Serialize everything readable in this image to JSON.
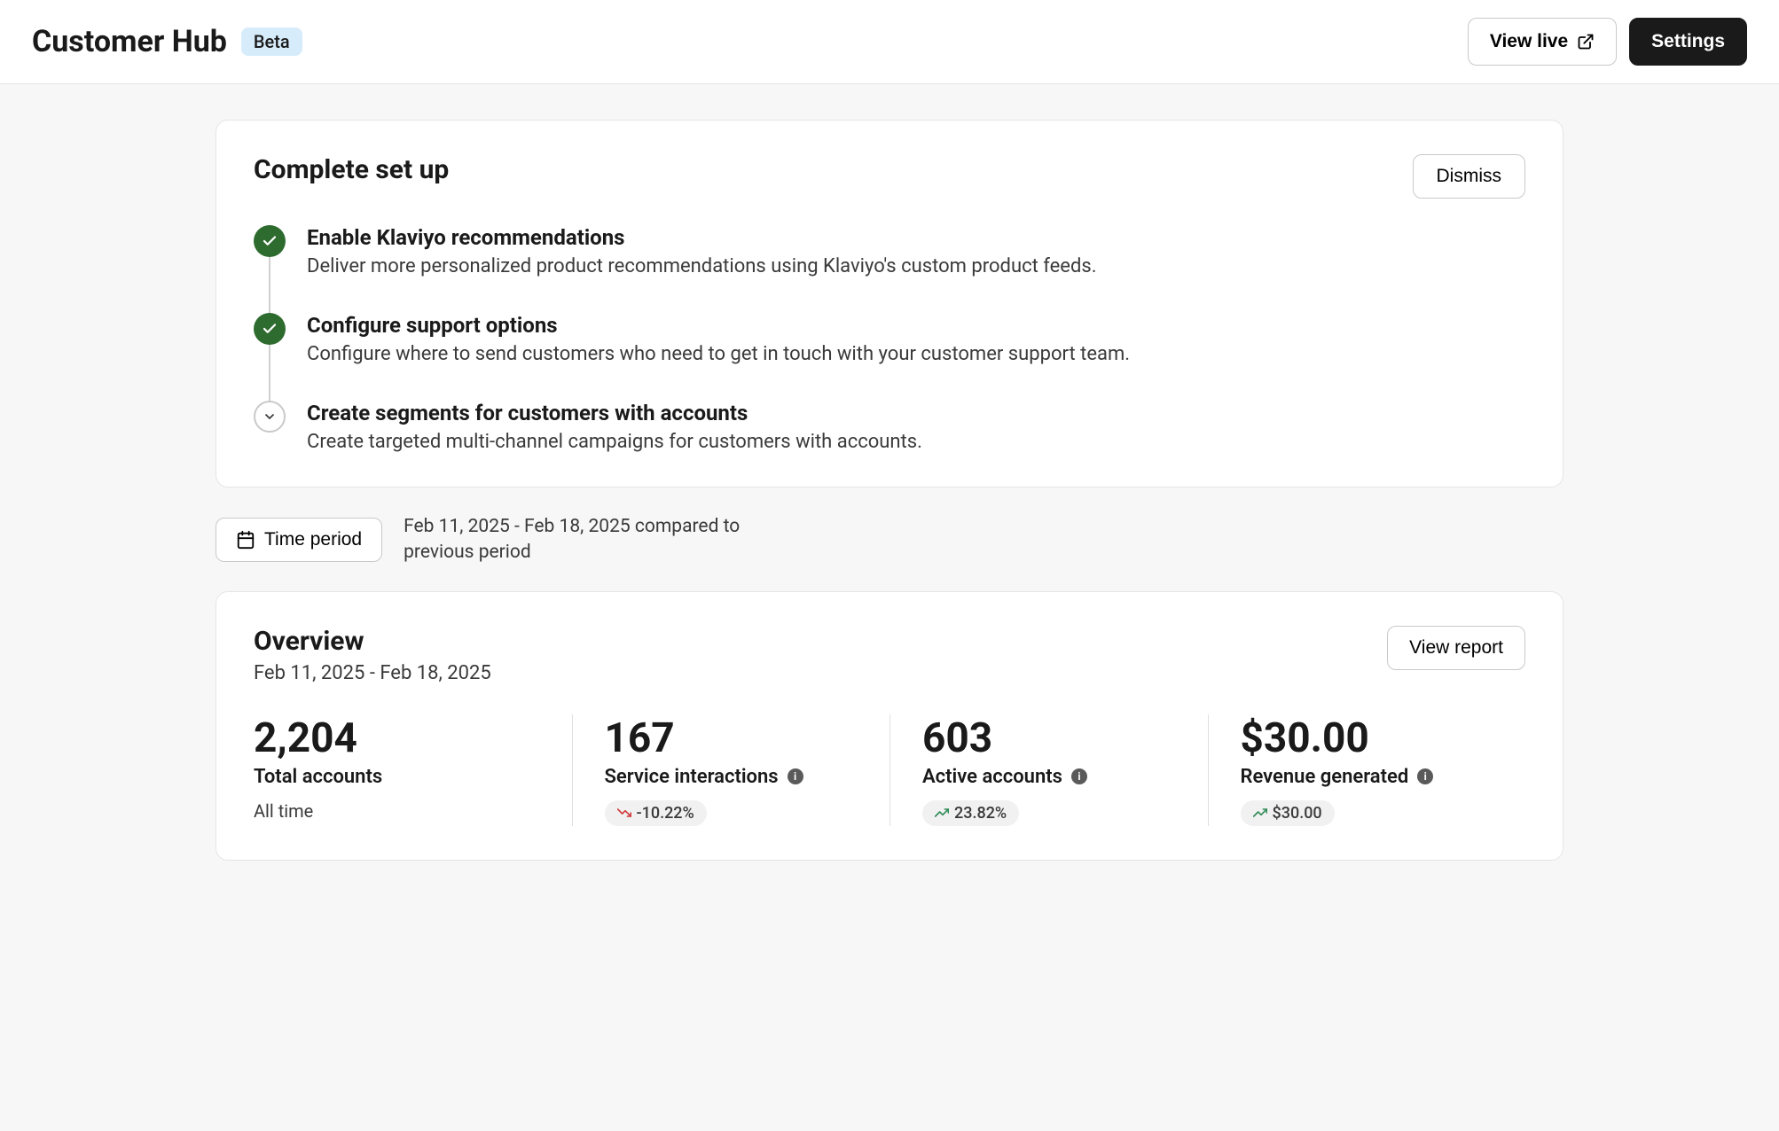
{
  "header": {
    "title": "Customer Hub",
    "badge": "Beta",
    "view_live_label": "View live",
    "settings_label": "Settings"
  },
  "setup": {
    "title": "Complete set up",
    "dismiss_label": "Dismiss",
    "steps": [
      {
        "status": "done",
        "title": "Enable Klaviyo recommendations",
        "desc": "Deliver more personalized product recommendations using Klaviyo's custom product feeds."
      },
      {
        "status": "done",
        "title": "Configure support options",
        "desc": "Configure where to send customers who need to get in touch with your customer support team."
      },
      {
        "status": "pending",
        "title": "Create segments for customers with accounts",
        "desc": "Create targeted multi-channel campaigns for customers with accounts."
      }
    ]
  },
  "time_period": {
    "button_label": "Time period",
    "description": "Feb 11, 2025 - Feb 18, 2025 compared to previous period"
  },
  "overview": {
    "title": "Overview",
    "subtitle": "Feb 11, 2025 - Feb 18, 2025",
    "view_report_label": "View report",
    "metrics": [
      {
        "value": "2,204",
        "label": "Total accounts",
        "sub": "All time",
        "has_info": false,
        "delta": null,
        "delta_direction": null
      },
      {
        "value": "167",
        "label": "Service interactions",
        "sub": null,
        "has_info": true,
        "delta": "-10.22%",
        "delta_direction": "down"
      },
      {
        "value": "603",
        "label": "Active accounts",
        "sub": null,
        "has_info": true,
        "delta": "23.82%",
        "delta_direction": "up"
      },
      {
        "value": "$30.00",
        "label": "Revenue generated",
        "sub": null,
        "has_info": true,
        "delta": "$30.00",
        "delta_direction": "up"
      }
    ]
  }
}
